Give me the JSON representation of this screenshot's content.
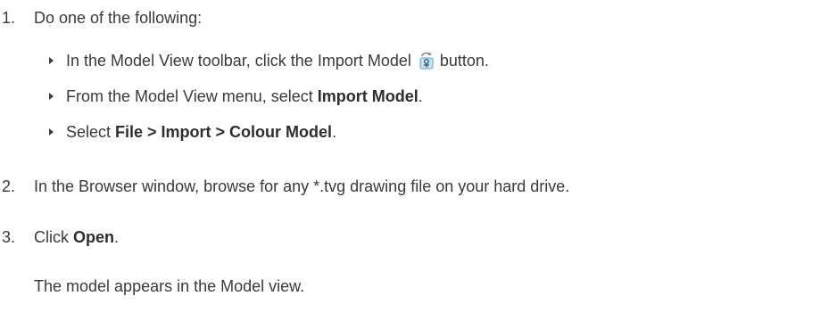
{
  "steps": [
    {
      "number": "1.",
      "text": "Do one of the following:",
      "options": [
        {
          "before": "In the Model View toolbar, click the Import Model",
          "after": "button."
        },
        {
          "before": "From the Model View menu, select ",
          "bold": "Import Model",
          "after": "."
        },
        {
          "before": "Select ",
          "bold": "File > Import > Colour Model",
          "after": "."
        }
      ]
    },
    {
      "number": "2.",
      "text": "In the Browser window, browse for any *.tvg drawing file on your hard drive."
    },
    {
      "number": "3.",
      "before": "Click ",
      "bold": "Open",
      "after": ".",
      "result": "The model appears in the Model view."
    }
  ],
  "icons": {
    "import_model": "import-model-icon"
  }
}
